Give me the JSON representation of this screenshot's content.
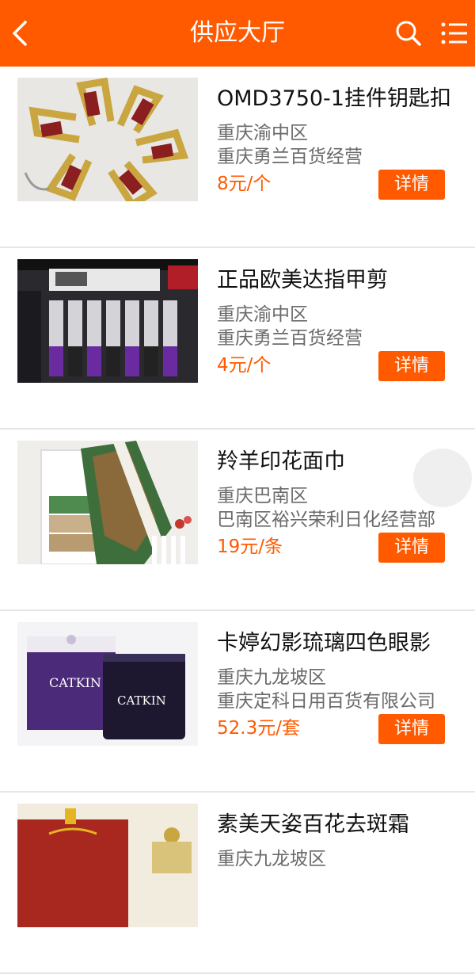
{
  "header": {
    "title": "供应大厅",
    "back_icon": "chevron-left-icon",
    "search_icon": "search-icon",
    "menu_icon": "menu-icon",
    "color": "#ff5a00"
  },
  "items": [
    {
      "name": "OMD3750-1挂件钥匙扣",
      "region": "重庆渝中区",
      "seller": "重庆勇兰百货经营",
      "price": "8元/个",
      "detail_label": "详情"
    },
    {
      "name": "正品欧美达指甲剪",
      "region": "重庆渝中区",
      "seller": "重庆勇兰百货经营",
      "price": "4元/个",
      "detail_label": "详情"
    },
    {
      "name": "羚羊印花面巾",
      "region": "重庆巴南区",
      "seller": "巴南区裕兴荣利日化经营部",
      "price": "19元/条",
      "detail_label": "详情"
    },
    {
      "name": "卡婷幻影琉璃四色眼影",
      "region": "重庆九龙坡区",
      "seller": "重庆定科日用百货有限公司",
      "price": "52.3元/套",
      "detail_label": "详情"
    },
    {
      "name": "素美天姿百花去斑霜",
      "region": "重庆九龙坡区",
      "seller": "",
      "price": "",
      "detail_label": ""
    }
  ],
  "product_images": {
    "catkin_brand_text": "CATKIN"
  }
}
